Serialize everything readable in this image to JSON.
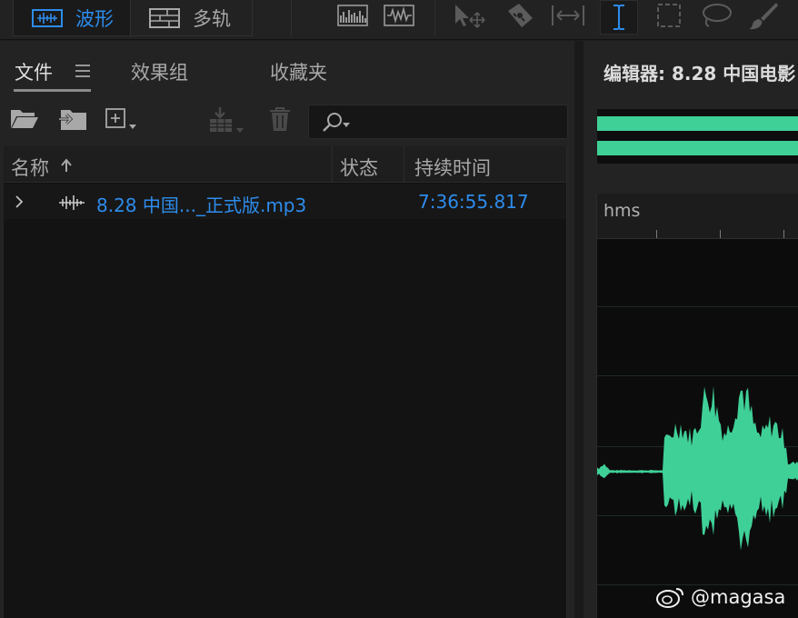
{
  "toolbar": {
    "modes": [
      {
        "label": "波形",
        "active": true
      },
      {
        "label": "多轨",
        "active": false
      }
    ],
    "tools": [
      "spectral-display-icon",
      "waveform-display-icon",
      "move-tool-icon",
      "razor-tool-icon",
      "slip-tool-icon",
      "time-selection-tool-icon",
      "marquee-tool-icon",
      "lasso-tool-icon",
      "brush-tool-icon"
    ]
  },
  "files_panel": {
    "tabs": [
      {
        "label": "文件",
        "active": true
      },
      {
        "label": "效果组",
        "active": false
      },
      {
        "label": "收藏夹",
        "active": false
      }
    ],
    "columns": {
      "name": "名称",
      "status": "状态",
      "duration": "持续时间"
    },
    "rows": [
      {
        "name": "8.28 中国..._正式版.mp3",
        "status": "",
        "duration": "7:36:55.817"
      }
    ]
  },
  "editor": {
    "title": "编辑器: 8.28 中国电影",
    "ruler_label": "hms"
  },
  "watermark": {
    "text": "@magasa"
  },
  "colors": {
    "accent": "#2d8ceb",
    "waveform": "#3fd098",
    "bg": "#232323"
  }
}
